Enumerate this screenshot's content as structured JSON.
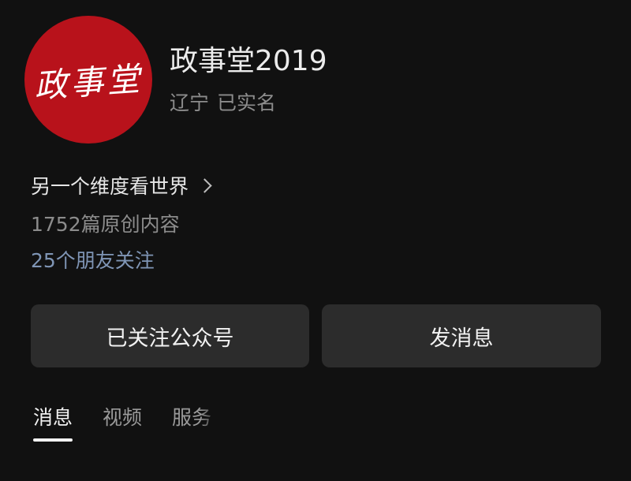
{
  "profile": {
    "avatar_text": "政事堂",
    "name": "政事堂2019",
    "location": "辽宁",
    "verification": "已实名",
    "intro": "另一个维度看世界",
    "articles": "1752篇原创内容",
    "friends": "25个朋友关注"
  },
  "actions": {
    "follow_label": "已关注公众号",
    "message_label": "发消息"
  },
  "tabs": [
    {
      "label": "消息",
      "active": true
    },
    {
      "label": "视频",
      "active": false
    },
    {
      "label": "服务",
      "active": false
    }
  ],
  "colors": {
    "background": "#111111",
    "avatar_red": "#b8121b",
    "link_blue": "#7f95b5",
    "button_bg": "#2c2c2c"
  }
}
